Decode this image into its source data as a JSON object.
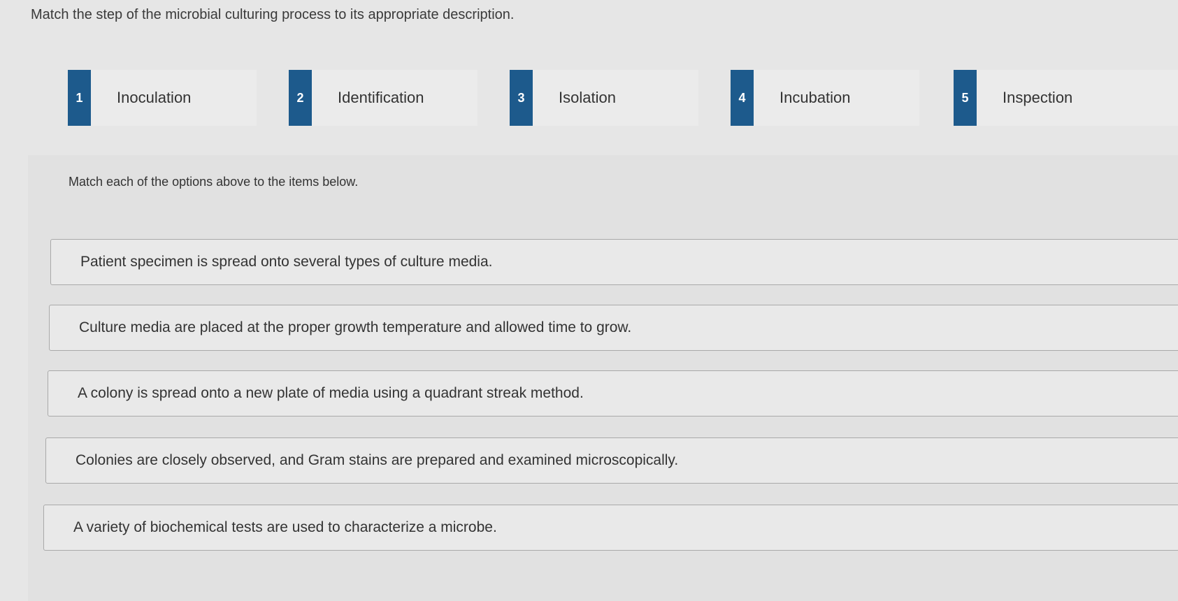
{
  "question": {
    "prompt": "Match the step of the microbial culturing process to its appropriate description."
  },
  "options": [
    {
      "number": "1",
      "label": "Inoculation"
    },
    {
      "number": "2",
      "label": "Identification"
    },
    {
      "number": "3",
      "label": "Isolation"
    },
    {
      "number": "4",
      "label": "Incubation"
    },
    {
      "number": "5",
      "label": "Inspection"
    }
  ],
  "match_area": {
    "instructions": "Match each of the options above to the items below.",
    "items": [
      "Patient specimen is spread onto several types of culture media.",
      "Culture media are placed at the proper growth temperature and allowed time to grow.",
      "A colony is spread onto a new plate of media using a quadrant streak method.",
      "Colonies are closely observed, and Gram stains are prepared and examined microscopically.",
      "A variety of biochemical tests are used to characterize a microbe."
    ]
  },
  "colors": {
    "badge": "#1d5a8c",
    "background": "#e6e6e6"
  }
}
